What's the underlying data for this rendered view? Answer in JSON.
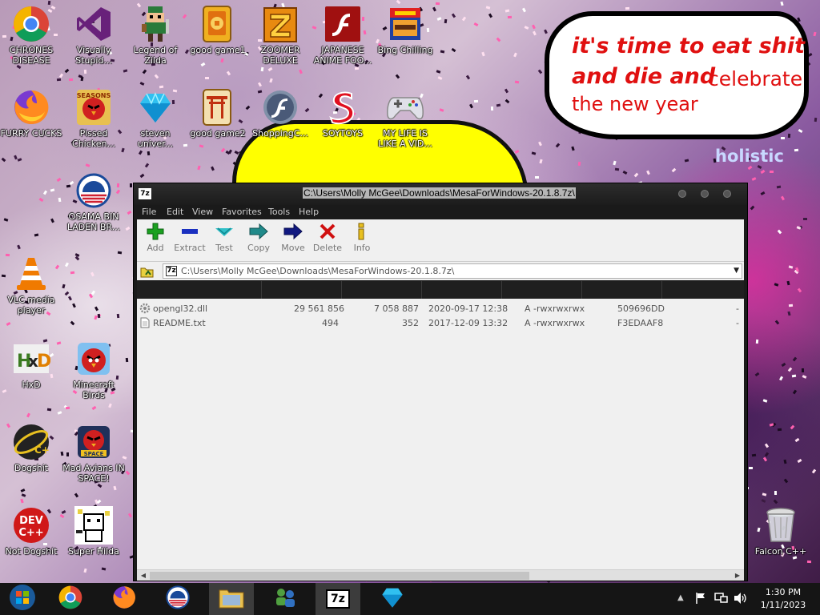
{
  "wallpaper": {
    "speech_line1": "it's time to eat shit",
    "speech_line2a": "and die and",
    "speech_line2b": "celebrate",
    "speech_line3": "the new year",
    "sign_text": "holistic"
  },
  "desktop_icons": [
    {
      "label": "CHRONES DISEASE",
      "icon": "chrome-icon"
    },
    {
      "label": "Visually Stupid...",
      "icon": "visual-studio-icon"
    },
    {
      "label": "Legend of Zilda",
      "icon": "pixel-hero-icon"
    },
    {
      "label": "good game1",
      "icon": "mahjong-tile-icon"
    },
    {
      "label": "ZOOMER DELUXE",
      "icon": "zoomer-icon"
    },
    {
      "label": "JAPANESE ANIME FOO...",
      "icon": "flash-icon"
    },
    {
      "label": "Bing Chilling",
      "icon": "burger-icon"
    },
    {
      "label": "FURRY CUCKS",
      "icon": "firefox-icon"
    },
    {
      "label": "Pissed Chicken...",
      "icon": "angry-bird-seasons-icon"
    },
    {
      "label": "steven univer...",
      "icon": "diamond-icon"
    },
    {
      "label": "good game2",
      "icon": "torii-gate-icon"
    },
    {
      "label": "ShoppingC...",
      "icon": "flash-circle-icon"
    },
    {
      "label": "SOYTOYS",
      "icon": "soytoys-icon"
    },
    {
      "label": "MY LIFE IS LIKE A VID...",
      "icon": "gamepad-icon"
    },
    {
      "label": "OSAMA BIN LADEN BR...",
      "icon": "obama-logo-icon"
    },
    {
      "label": "VLC media player",
      "icon": "vlc-cone-icon"
    },
    {
      "label": "HxD",
      "icon": "hxd-icon"
    },
    {
      "label": "Minecraft Birds",
      "icon": "angry-bird-icon"
    },
    {
      "label": "Dogshit",
      "icon": "dogshit-icon"
    },
    {
      "label": "Mad Avians IN SPACE!",
      "icon": "angry-birds-space-icon"
    },
    {
      "label": "Not Dogshit",
      "icon": "dev-cpp-icon"
    },
    {
      "label": "Super Hilda",
      "icon": "pixel-cat-icon"
    },
    {
      "label": "Falcon C++",
      "icon": "recycle-bin-icon"
    }
  ],
  "window": {
    "title": "C:\\Users\\Molly McGee\\Downloads\\MesaForWindows-20.1.8.7z\\",
    "app_badge": "7z",
    "menu": [
      "File",
      "Edit",
      "View",
      "Favorites",
      "Tools",
      "Help"
    ],
    "toolbar": [
      {
        "label": "Add",
        "icon": "plus-icon"
      },
      {
        "label": "Extract",
        "icon": "minus-icon"
      },
      {
        "label": "Test",
        "icon": "check-arrow-icon"
      },
      {
        "label": "Copy",
        "icon": "copy-arrow-icon"
      },
      {
        "label": "Move",
        "icon": "move-arrow-icon"
      },
      {
        "label": "Delete",
        "icon": "delete-x-icon"
      },
      {
        "label": "Info",
        "icon": "info-icon"
      }
    ],
    "path": "C:\\Users\\Molly McGee\\Downloads\\MesaForWindows-20.1.8.7z\\",
    "files": [
      {
        "name": "opengl32.dll",
        "size": "29 561 856",
        "packed": "7 058 887",
        "modified": "2020-09-17 12:38",
        "attributes": "A -rwxrwxrwx",
        "crc": "509696DD",
        "extra": "-",
        "icon": "dll-gear-icon"
      },
      {
        "name": "README.txt",
        "size": "494",
        "packed": "352",
        "modified": "2017-12-09 13:32",
        "attributes": "A -rwxrwxrwx",
        "crc": "F3EDAAF8",
        "extra": "-",
        "icon": "text-file-icon"
      }
    ]
  },
  "taskbar": {
    "items": [
      "win7-start-icon",
      "chrome-icon",
      "firefox-icon",
      "obama-logo-icon",
      "file-explorer-icon",
      "network-people-icon",
      "7zip-icon",
      "diamond-icon"
    ],
    "badge_7z": "7z",
    "time": "1:30 PM",
    "date": "1/11/2023"
  }
}
